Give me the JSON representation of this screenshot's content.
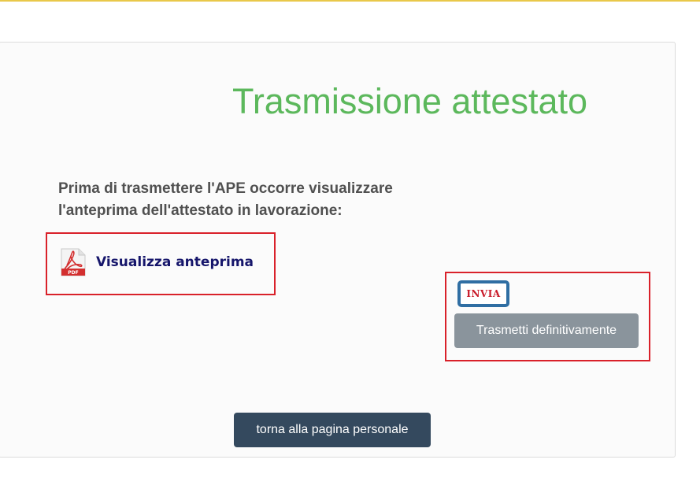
{
  "page": {
    "title": "Trasmissione attestato",
    "intro_line1": "Prima di trasmettere l'APE occorre visualizzare",
    "intro_line2": "l'anteprima dell'attestato in lavorazione:"
  },
  "preview": {
    "icon": "pdf-file-icon",
    "icon_text": "PDF",
    "label": "Visualizza anteprima"
  },
  "send": {
    "stamp_icon": "invia-stamp-icon",
    "stamp_text": "INVIA",
    "button_label": "Trasmetti definitivamente"
  },
  "footer": {
    "back_button_label": "torna alla pagina personale"
  },
  "colors": {
    "title_green": "#5cb85c",
    "highlight_red": "#d9212a",
    "link_navy": "#16166b",
    "send_button_gray": "#8a949c",
    "back_button_dark": "#34495e"
  }
}
